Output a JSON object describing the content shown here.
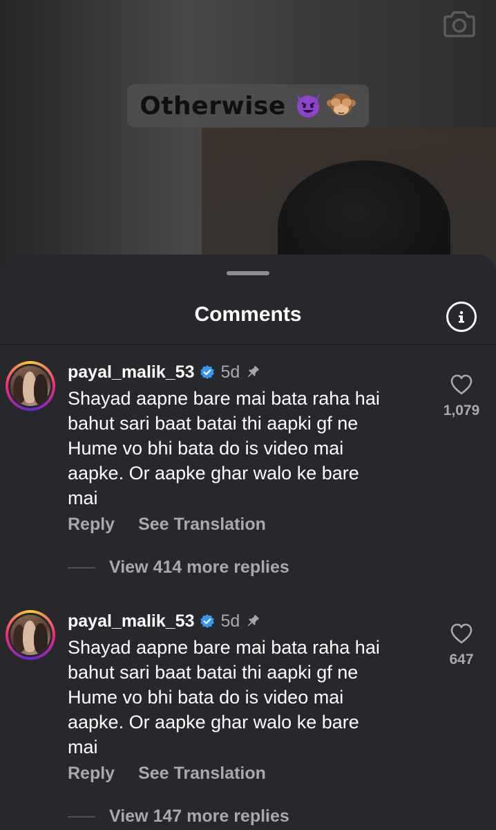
{
  "video": {
    "caption_text": "Otherwise",
    "caption_emojis": [
      "smiling-devil-emoji",
      "see-no-evil-monkey-emoji"
    ],
    "camera_icon": "camera-icon"
  },
  "sheet": {
    "title": "Comments",
    "info_icon": "info-icon"
  },
  "comments": [
    {
      "username": "payal_malik_53",
      "verified": true,
      "time": "5d",
      "pinned": true,
      "text_lines": [
        "Shayad aapne bare mai bata raha hai",
        "bahut sari baat batai thi aapki gf ne",
        "Hume vo bhi bata do is video mai",
        "aapke.  Or aapke ghar walo ke bare",
        "mai"
      ],
      "likes": "1,079",
      "reply_label": "Reply",
      "translate_label": "See Translation",
      "view_replies": "View 414 more replies"
    },
    {
      "username": "payal_malik_53",
      "verified": true,
      "time": "5d",
      "pinned": true,
      "text_lines": [
        "Shayad aapne bare mai bata raha hai",
        "bahut sari baat batai thi aapki gf ne",
        "Hume vo bhi bata do is video mai",
        "aapke.  Or aapke ghar walo ke bare",
        "mai"
      ],
      "likes": "647",
      "reply_label": "Reply",
      "translate_label": "See Translation",
      "view_replies": "View 147 more replies"
    }
  ],
  "colors": {
    "sheet_bg": "#26282c",
    "secondary_text": "#a8a9ad",
    "verified_blue": "#3897f0"
  }
}
